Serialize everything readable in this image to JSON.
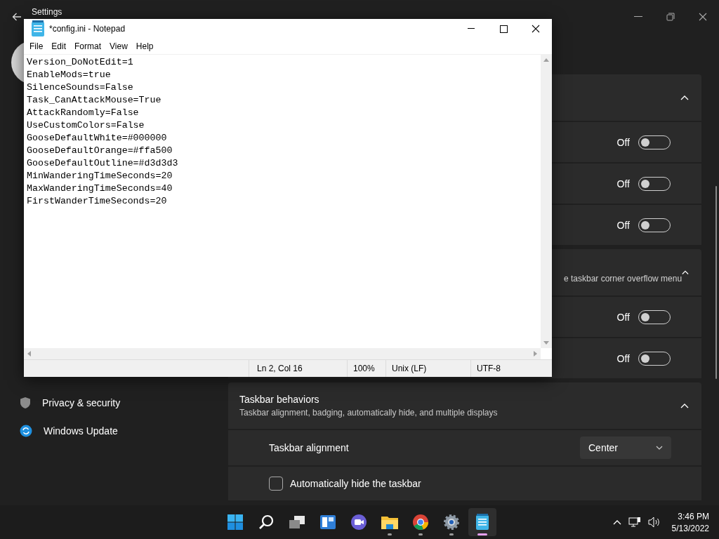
{
  "settings_window": {
    "title": "Settings",
    "sidebar": {
      "items": [
        {
          "label": "Privacy & security"
        },
        {
          "label": "Windows Update"
        }
      ]
    },
    "sections": [
      {
        "expanded": true,
        "rows": [
          {
            "kind": "toggle",
            "state_label": "Off",
            "on": false
          },
          {
            "kind": "toggle",
            "state_label": "Off",
            "on": false
          },
          {
            "kind": "toggle",
            "state_label": "Off",
            "on": false
          }
        ]
      },
      {
        "title_fragment": "e taskbar corner overflow menu",
        "expanded": true,
        "rows": [
          {
            "kind": "toggle",
            "state_label": "Off",
            "on": false
          },
          {
            "kind": "toggle",
            "state_label": "Off",
            "on": false
          }
        ]
      },
      {
        "title": "Taskbar behaviors",
        "subtitle": "Taskbar alignment, badging, automatically hide, and multiple displays",
        "expanded": true,
        "rows": [
          {
            "kind": "dropdown",
            "label": "Taskbar alignment",
            "value": "Center"
          },
          {
            "kind": "checkbox",
            "label": "Automatically hide the taskbar",
            "checked": false
          }
        ]
      }
    ]
  },
  "notepad": {
    "title": "*config.ini - Notepad",
    "menu": [
      "File",
      "Edit",
      "Format",
      "View",
      "Help"
    ],
    "lines": [
      "Version_DoNotEdit=1",
      "EnableMods=true",
      "SilenceSounds=False",
      "Task_CanAttackMouse=True",
      "AttackRandomly=False",
      "UseCustomColors=False",
      "GooseDefaultWhite=#000000",
      "GooseDefaultOrange=#ffa500",
      "GooseDefaultOutline=#d3d3d3",
      "MinWanderingTimeSeconds=20",
      "MaxWanderingTimeSeconds=40",
      "FirstWanderTimeSeconds=20"
    ],
    "status": {
      "position": "Ln 2, Col 16",
      "zoom": "100%",
      "line_ending": "Unix (LF)",
      "encoding": "UTF-8"
    }
  },
  "taskbar": {
    "apps": [
      {
        "kind": "start",
        "running": false,
        "active": false
      },
      {
        "kind": "search",
        "running": false,
        "active": false
      },
      {
        "kind": "taskview",
        "running": false,
        "active": false
      },
      {
        "kind": "widgets",
        "running": false,
        "active": false
      },
      {
        "kind": "chat",
        "running": false,
        "active": false
      },
      {
        "kind": "explorer",
        "running": true,
        "active": false
      },
      {
        "kind": "chrome",
        "running": true,
        "active": false
      },
      {
        "kind": "settings",
        "running": true,
        "active": false
      },
      {
        "kind": "notepad",
        "running": true,
        "active": true
      }
    ],
    "clock": {
      "time": "3:46 PM",
      "date": "5/13/2022"
    }
  }
}
